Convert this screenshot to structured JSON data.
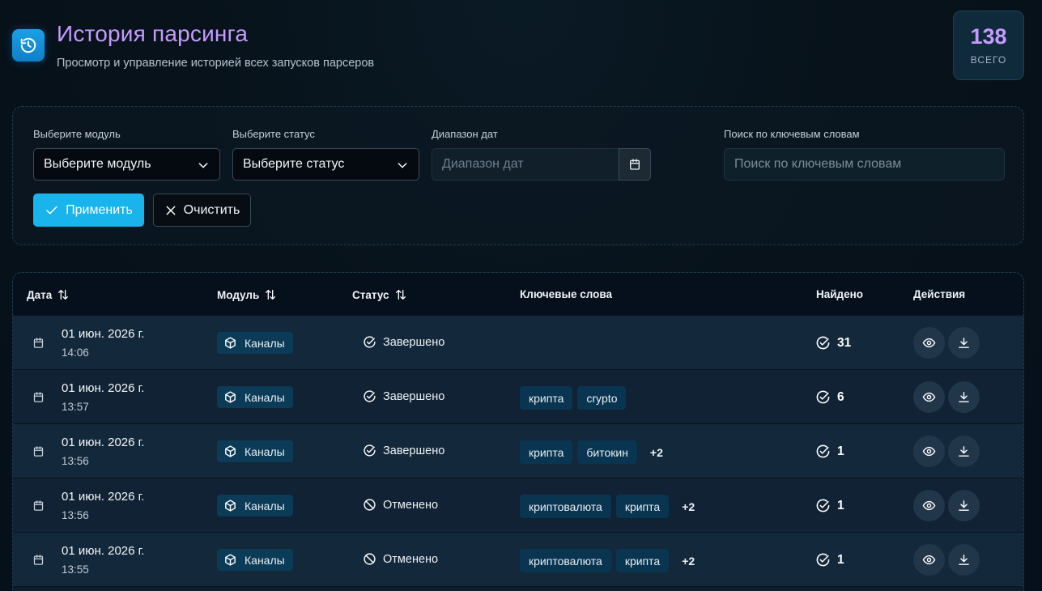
{
  "header": {
    "title": "История парсинга",
    "subtitle": "Просмотр и управление историей всех запусков парсеров",
    "total_value": "138",
    "total_label": "ВСЕГО"
  },
  "filters": {
    "module_label": "Выберите модуль",
    "module_value": "Выберите модуль",
    "status_label": "Выберите статус",
    "status_value": "Выберите статус",
    "date_label": "Диапазон дат",
    "date_placeholder": "Диапазон дат",
    "search_label": "Поиск по ключевым словам",
    "search_placeholder": "Поиск по ключевым словам",
    "apply_label": "Применить",
    "clear_label": "Очистить"
  },
  "table": {
    "columns": {
      "date": "Дата",
      "module": "Модуль",
      "status": "Статус",
      "keywords": "Ключевые слова",
      "found": "Найдено",
      "actions": "Действия"
    },
    "rows": [
      {
        "date": "01 июн. 2026 г.",
        "time": "14:06",
        "module": "Каналы",
        "status": "Завершено",
        "status_icon": "check-circle-icon",
        "keywords": [],
        "more": "",
        "found": "31"
      },
      {
        "date": "01 июн. 2026 г.",
        "time": "13:57",
        "module": "Каналы",
        "status": "Завершено",
        "status_icon": "check-circle-icon",
        "keywords": [
          "крипта",
          "crypto"
        ],
        "more": "",
        "found": "6"
      },
      {
        "date": "01 июн. 2026 г.",
        "time": "13:56",
        "module": "Каналы",
        "status": "Завершено",
        "status_icon": "check-circle-icon",
        "keywords": [
          "крипта",
          "битокин"
        ],
        "more": "+2",
        "found": "1"
      },
      {
        "date": "01 июн. 2026 г.",
        "time": "13:56",
        "module": "Каналы",
        "status": "Отменено",
        "status_icon": "cancel-circle-icon",
        "keywords": [
          "криптовалюта",
          "крипта"
        ],
        "more": "+2",
        "found": "1"
      },
      {
        "date": "01 июн. 2026 г.",
        "time": "13:55",
        "module": "Каналы",
        "status": "Отменено",
        "status_icon": "cancel-circle-icon",
        "keywords": [
          "криптовалюта",
          "крипта"
        ],
        "more": "+2",
        "found": "1"
      }
    ]
  },
  "colors": {
    "accent": "#19b4ec",
    "title": "#c59bff",
    "badge": "#0b3b56"
  }
}
